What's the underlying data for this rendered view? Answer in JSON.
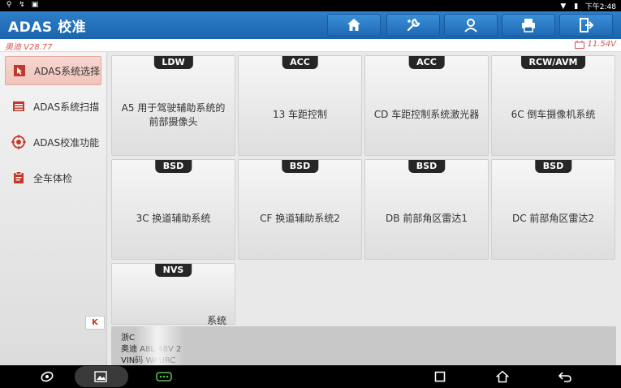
{
  "statusbar": {
    "time": "下午2:48"
  },
  "header": {
    "title": "ADAS 校准"
  },
  "info": {
    "version": "奥迪 V28.77",
    "voltage": "11.54V"
  },
  "sidebar": {
    "items": [
      {
        "label": "ADAS系统选择",
        "icon": "cursor-icon",
        "active": true
      },
      {
        "label": "ADAS系统扫描",
        "icon": "list-icon",
        "active": false
      },
      {
        "label": "ADAS校准功能",
        "icon": "target-icon",
        "active": false
      },
      {
        "label": "全车体检",
        "icon": "clipboard-icon",
        "active": false
      }
    ],
    "collapse_label": "K"
  },
  "cards": [
    {
      "tag": "LDW",
      "label": "A5 用于驾驶辅助系统的前部摄像头"
    },
    {
      "tag": "ACC",
      "label": "13 车距控制"
    },
    {
      "tag": "ACC",
      "label": "CD 车距控制系统激光器"
    },
    {
      "tag": "RCW/AVM",
      "label": "6C 倒车摄像机系统"
    },
    {
      "tag": "BSD",
      "label": "3C 换道辅助系统"
    },
    {
      "tag": "BSD",
      "label": "CF 换道辅助系统2"
    },
    {
      "tag": "BSD",
      "label": "DB 前部角区雷达1"
    },
    {
      "tag": "BSD",
      "label": "DC 前部角区雷达2"
    },
    {
      "tag": "NVS",
      "label": "系统"
    }
  ],
  "vehicle": {
    "line1": "浙C",
    "line2": "奥迪 A8L 48V 2",
    "line3": "VIN码 WAURC"
  },
  "colors": {
    "accent": "#1b63ad",
    "active_bg": "#f0c4bb",
    "warning": "#d9534f"
  }
}
